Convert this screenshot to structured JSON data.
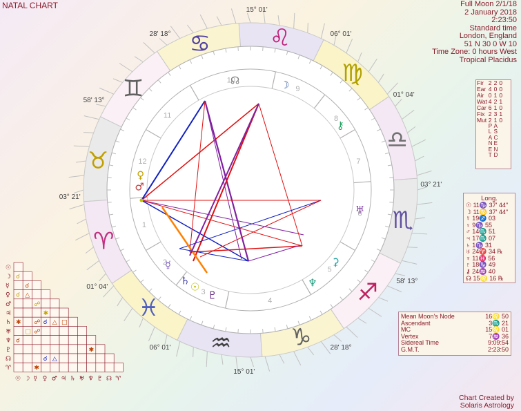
{
  "title": "NATAL CHART",
  "info": [
    "Full Moon 2/1/18",
    "2 January 2018",
    "2:23:50",
    "Standard time",
    "London, England",
    "51 N 30    0 W 10",
    "Time Zone: 0 hours West",
    "Tropical Placidus"
  ],
  "wheel": {
    "sign_glyphs": [
      "♌",
      "♋",
      "♊",
      "♉",
      "♈",
      "♓",
      "♒",
      "♑",
      "♐",
      "♏",
      "♎",
      "♍"
    ],
    "cusp_labels": [
      "15° 01'",
      "06° 01'",
      "01° 04'",
      "03° 21'",
      "58' 13°",
      "28' 18°",
      "15° 01'",
      "06° 01'",
      "01° 04'",
      "03° 21'",
      "58' 13°",
      "28' 18°"
    ],
    "house_numbers": [
      "9",
      "8",
      "7",
      "6",
      "5",
      "4",
      "3",
      "2",
      "1",
      "12",
      "11",
      "10"
    ],
    "planet_glyphs": [
      "☊",
      "☽",
      "⚷",
      "♅",
      "⚳",
      "♆",
      "♇",
      "☉",
      "♄",
      "☿",
      "♀",
      "♂"
    ]
  },
  "elements": {
    "rows": [
      [
        "Fir",
        "2",
        "2",
        "0"
      ],
      [
        "Ear",
        "4",
        "0",
        "0"
      ],
      [
        "Air",
        "0",
        "1",
        "0"
      ],
      [
        "Wat",
        "4",
        "2",
        "1"
      ],
      [
        "Car",
        "6",
        "1",
        "0"
      ],
      [
        "Fix",
        "2",
        "3",
        "1"
      ],
      [
        "Mut",
        "2",
        "1",
        "0"
      ]
    ],
    "col_headers": [
      "PLANET",
      "ASCEND"
    ]
  },
  "positions": {
    "header": "Long.",
    "rows": [
      "☉ 11♑ 37' 44\"",
      "☽ 11♋ 37' 44\"",
      "☿ 19♐ 03",
      "♀ 9♑ 55",
      "♂ 14♏ 51",
      "♃ 17♏ 07",
      "♄ 1♑ 31",
      "♅ 24♈ 34 ℞",
      "♆ 11♓ 56",
      "♇ 18♑ 49",
      "⚷ 24♒ 40",
      "☊ 15♌ 16 ℞"
    ]
  },
  "points": [
    {
      "label": "Mean Moon's Node",
      "value": "16♌ 50"
    },
    {
      "label": "Ascendant",
      "value": "3♏ 21"
    },
    {
      "label": "MC",
      "value": "15♌ 01"
    },
    {
      "label": "Vertex",
      "value": "7♒ 36"
    },
    {
      "label": "Sidereal Time",
      "value": "9:09:54"
    },
    {
      "label": "G.M.T.",
      "value": "2:23:50"
    }
  ],
  "aspect_grid": {
    "planets": [
      "☉",
      "☽",
      "☿",
      "♀",
      "♂",
      "♃",
      "♄",
      "♅",
      "♆",
      "♇",
      "☊",
      "♈",
      "M"
    ],
    "marks": [
      "☌",
      "☌",
      "△",
      "✱",
      "✱",
      "☍",
      "☌",
      "△",
      "□",
      "□",
      "☍"
    ]
  },
  "credit": [
    "Chart Created by",
    "Solaris Astrology"
  ],
  "colors": {
    "accent": "#8a1a2a",
    "red": "#e01010",
    "blue": "#1020c0",
    "purple": "#8020a0",
    "orange": "#ff8000"
  }
}
